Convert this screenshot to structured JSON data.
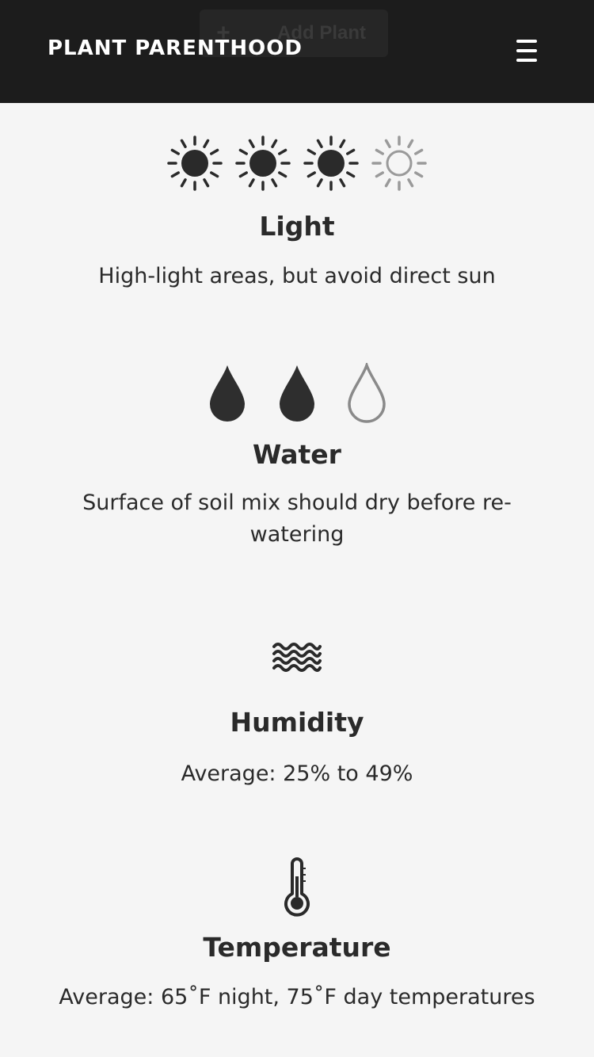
{
  "header": {
    "brand": "PLANT PARENTHOOD",
    "add_button_icon": "+",
    "add_button_label": "Add Plant",
    "menu_icon": "hamburger-menu-icon",
    "background": "#1c1c1c"
  },
  "light": {
    "title": "Light",
    "description": "High-light areas, but avoid direct sun",
    "rating": 3,
    "max": 4,
    "icon": "sun-icon"
  },
  "water": {
    "title": "Water",
    "description": "Surface of soil mix should dry before re-watering",
    "rating": 2,
    "max": 3,
    "icon": "water-drop-icon"
  },
  "humidity": {
    "title": "Humidity",
    "description": "Average: 25% to 49%",
    "icon": "waves-icon"
  },
  "temperature": {
    "title": "Temperature",
    "description": "Average: 65˚F night, 75˚F day temperatures",
    "icon": "thermometer-icon"
  }
}
